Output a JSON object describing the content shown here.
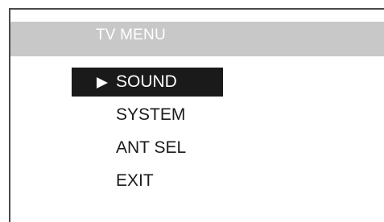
{
  "title": "TV MENU",
  "menu": {
    "items": [
      {
        "label": "SOUND",
        "selected": true
      },
      {
        "label": "SYSTEM",
        "selected": false
      },
      {
        "label": "ANT SEL",
        "selected": false
      },
      {
        "label": "EXIT",
        "selected": false
      }
    ]
  },
  "colors": {
    "title_bar": "#c8c8c8",
    "title_text": "#ffffff",
    "selected_bg": "#1a1a1a",
    "text": "#1a1a1a"
  },
  "icons": {
    "selector": "triangle-right-icon"
  }
}
